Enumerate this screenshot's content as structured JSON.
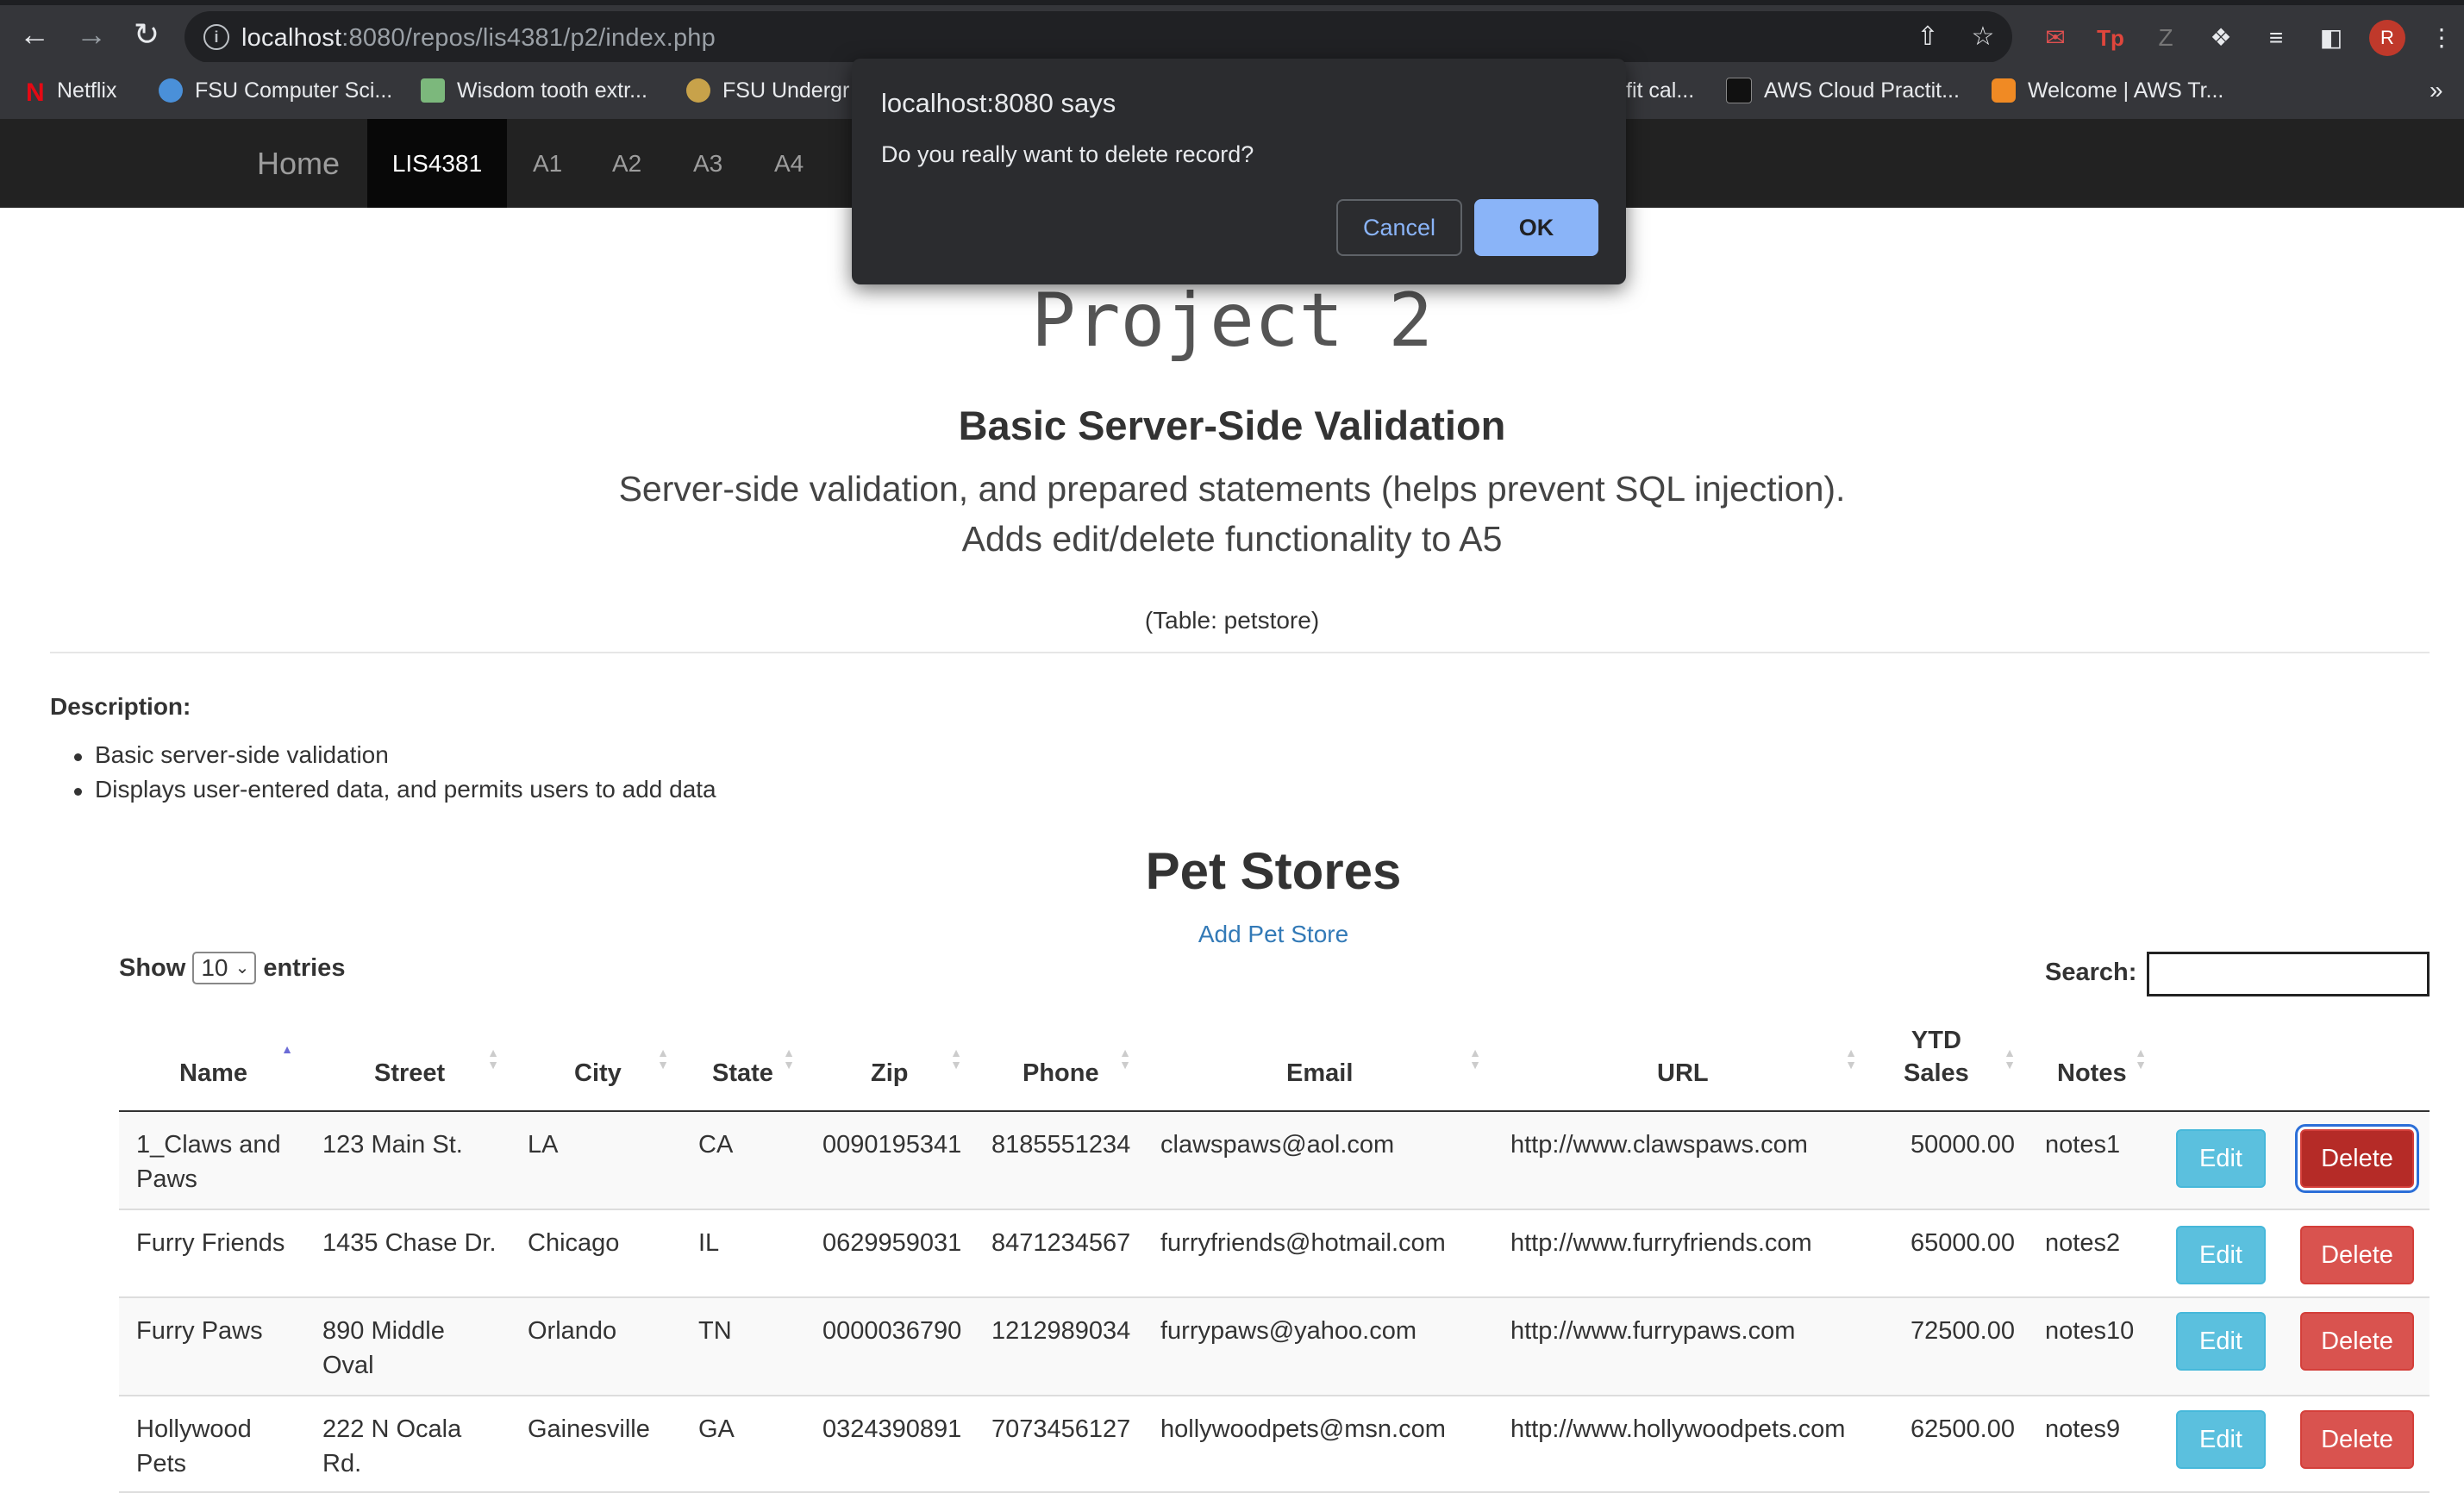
{
  "browser": {
    "url_host": "localhost",
    "url_rest": ":8080/repos/lis4381/p2/index.php",
    "bookmarks": [
      {
        "label": "Netflix",
        "icon": "netflix-icon",
        "color": "#e50914"
      },
      {
        "label": "FSU Computer Sci...",
        "icon": "globe-icon",
        "color": "#4a90d9"
      },
      {
        "label": "Wisdom tooth extr...",
        "icon": "pattern-icon",
        "color": "#7cb87c"
      },
      {
        "label": "FSU Undergr",
        "icon": "seal-icon",
        "color": "#c8a24a"
      },
      {
        "label": "fit cal...",
        "icon": "",
        "color": ""
      },
      {
        "label": "AWS Cloud Practit...",
        "icon": "aws-icon",
        "color": "#111111"
      },
      {
        "label": "Welcome | AWS Tr...",
        "icon": "cube-icon",
        "color": "#f08a24"
      }
    ],
    "avatar_letter": "R"
  },
  "nav": {
    "brand": "Home",
    "items": [
      "LIS4381",
      "A1",
      "A2",
      "A3",
      "A4"
    ],
    "active": "LIS4381"
  },
  "page": {
    "title": "Project 2",
    "subtitle": "Basic Server-Side Validation",
    "lead_line1": "Server-side validation, and prepared statements (helps prevent SQL injection).",
    "lead_line2": "Adds edit/delete functionality to A5",
    "table_note": "(Table: petstore)",
    "description_label": "Description:",
    "bullets": [
      "Basic server-side validation",
      "Displays user-entered data, and permits users to add data"
    ]
  },
  "petstores": {
    "heading": "Pet Stores",
    "add_link": "Add Pet Store",
    "show_label": "Show",
    "entries_label": "entries",
    "page_size": "10",
    "search_label": "Search:",
    "columns": {
      "name": "Name",
      "street": "Street",
      "city": "City",
      "state": "State",
      "zip": "Zip",
      "phone": "Phone",
      "email": "Email",
      "url": "URL",
      "ytd_line1": "YTD",
      "ytd_line2": "Sales",
      "notes": "Notes"
    },
    "edit_label": "Edit",
    "delete_label": "Delete",
    "rows": [
      {
        "name1": "1_Claws and",
        "name2": "Paws",
        "street1": "123 Main St.",
        "street2": "",
        "city": "LA",
        "state": "CA",
        "zip": "0090195341",
        "phone": "8185551234",
        "email": "clawspaws@aol.com",
        "url": "http://www.clawspaws.com",
        "ytd": "50000.00",
        "notes": "notes1"
      },
      {
        "name1": "Furry Friends",
        "name2": "",
        "street1": "1435 Chase Dr.",
        "street2": "",
        "city": "Chicago",
        "state": "IL",
        "zip": "0629959031",
        "phone": "8471234567",
        "email": "furryfriends@hotmail.com",
        "url": "http://www.furryfriends.com",
        "ytd": "65000.00",
        "notes": "notes2"
      },
      {
        "name1": "Furry Paws",
        "name2": "",
        "street1": "890 Middle",
        "street2": "Oval",
        "city": "Orlando",
        "state": "TN",
        "zip": "0000036790",
        "phone": "1212989034",
        "email": "furrypaws@yahoo.com",
        "url": "http://www.furrypaws.com",
        "ytd": "72500.00",
        "notes": "notes10"
      },
      {
        "name1": "Hollywood",
        "name2": "Pets",
        "street1": "222 N Ocala",
        "street2": "Rd.",
        "city": "Gainesville",
        "state": "GA",
        "zip": "0324390891",
        "phone": "7073456127",
        "email": "hollywoodpets@msn.com",
        "url": "http://www.hollywoodpets.com",
        "ytd": "62500.00",
        "notes": "notes9"
      }
    ]
  },
  "dialog": {
    "title": "localhost:8080 says",
    "message": "Do you really want to delete record?",
    "cancel_label": "Cancel",
    "ok_label": "OK"
  }
}
